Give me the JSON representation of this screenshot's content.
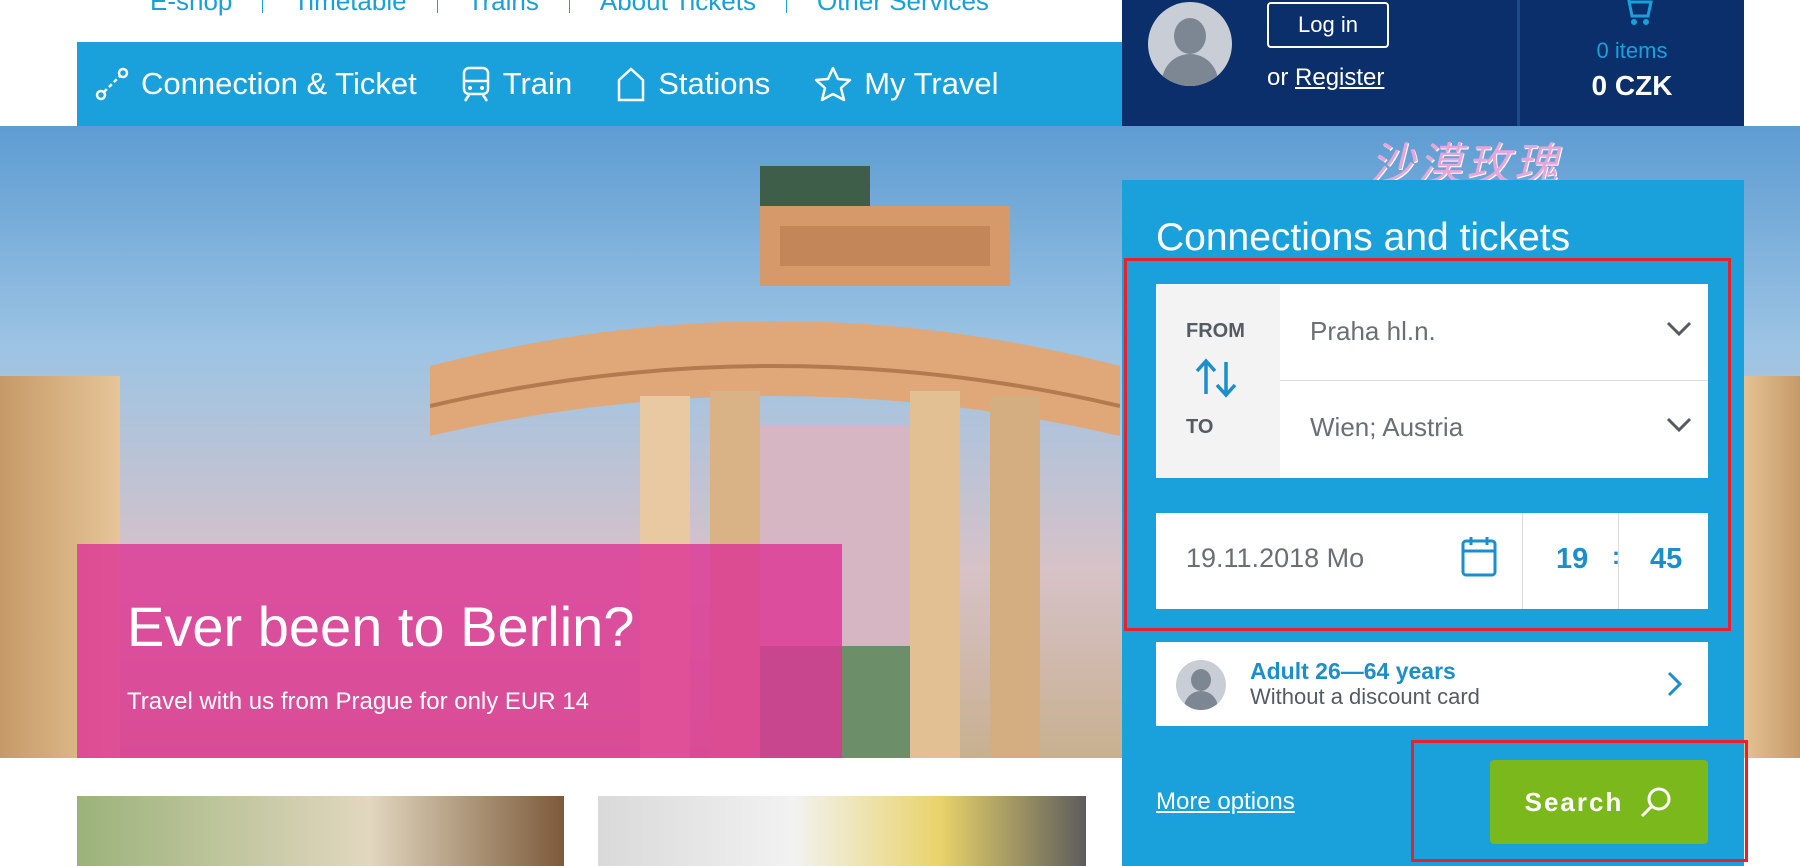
{
  "top_links": [
    "E-shop",
    "Timetable",
    "Trains",
    "About Tickets",
    "Other Services"
  ],
  "nav": {
    "items": [
      {
        "label": "Connection & Ticket",
        "icon": "route-icon"
      },
      {
        "label": "Train",
        "icon": "train-icon"
      },
      {
        "label": "Stations",
        "icon": "station-icon"
      },
      {
        "label": "My Travel",
        "icon": "star-icon"
      }
    ]
  },
  "user": {
    "login_label": "Log in",
    "or_text": "or",
    "register_label": "Register"
  },
  "cart": {
    "items_text": "0 items",
    "total": "0 CZK"
  },
  "hero": {
    "title": "Ever been to Berlin?",
    "subtitle": "Travel with us from Prague for only EUR 14",
    "slides": 3,
    "active_slide": 3
  },
  "search": {
    "title": "Connections and tickets",
    "from_label": "FROM",
    "from_value": "Praha hl.n.",
    "to_label": "TO",
    "to_value": "Wien; Austria",
    "date": "19.11.2018 Mo",
    "hour": "19",
    "time_sep": ":",
    "minute": "45",
    "passenger_title": "Adult 26—64 years",
    "passenger_subtitle": "Without a discount card",
    "more_options": "More options",
    "search_label": "Search"
  },
  "watermark": "沙漠玫瑰",
  "colors": {
    "nav_blue": "#1aa1dc",
    "dark_navy": "#0b2f6b",
    "promo_pink": "#dd3696",
    "search_green": "#7ab81c",
    "highlight_red": "#e8212e"
  }
}
